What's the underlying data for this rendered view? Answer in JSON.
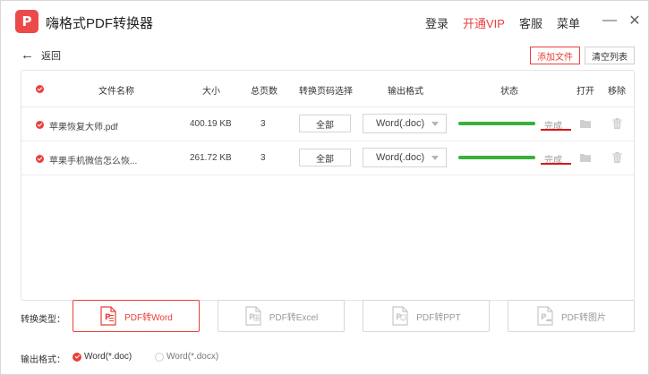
{
  "app": {
    "title": "嗨格式PDF转换器",
    "logo_glyph": "P",
    "accent_color": "#e8403c"
  },
  "nav": {
    "login": "登录",
    "vip": "开通VIP",
    "support": "客服",
    "menu": "菜单"
  },
  "window": {
    "minimize": "—",
    "close": "✕"
  },
  "toolbar": {
    "back_label": "返回",
    "add_file": "添加文件",
    "clear_list": "清空列表"
  },
  "table": {
    "headers": {
      "name": "文件名称",
      "size": "大小",
      "pages": "总页数",
      "range": "转换页码选择",
      "format": "输出格式",
      "status": "状态",
      "open": "打开",
      "remove": "移除"
    },
    "rows": [
      {
        "name": "苹果恢复大师.pdf",
        "size": "400.19 KB",
        "pages": "3",
        "range": "全部",
        "format": "Word(.doc)",
        "progress": 1.0,
        "status": "完成",
        "progress_color": "#37b23a"
      },
      {
        "name": "苹果手机微信怎么恢...",
        "size": "261.72 KB",
        "pages": "3",
        "range": "全部",
        "format": "Word(.doc)",
        "progress": 1.0,
        "status": "完成",
        "progress_color": "#37b23a"
      }
    ]
  },
  "convert_type": {
    "label": "转换类型：",
    "options": [
      {
        "label": "PDF转Word",
        "selected": true
      },
      {
        "label": "PDF转Excel",
        "selected": false
      },
      {
        "label": "PDF转PPT",
        "selected": false
      },
      {
        "label": "PDF转图片",
        "selected": false
      }
    ]
  },
  "output_format": {
    "label": "输出格式：",
    "options": [
      {
        "label": "Word(*.doc)",
        "selected": true
      },
      {
        "label": "Word(*.docx)",
        "selected": false
      }
    ]
  }
}
